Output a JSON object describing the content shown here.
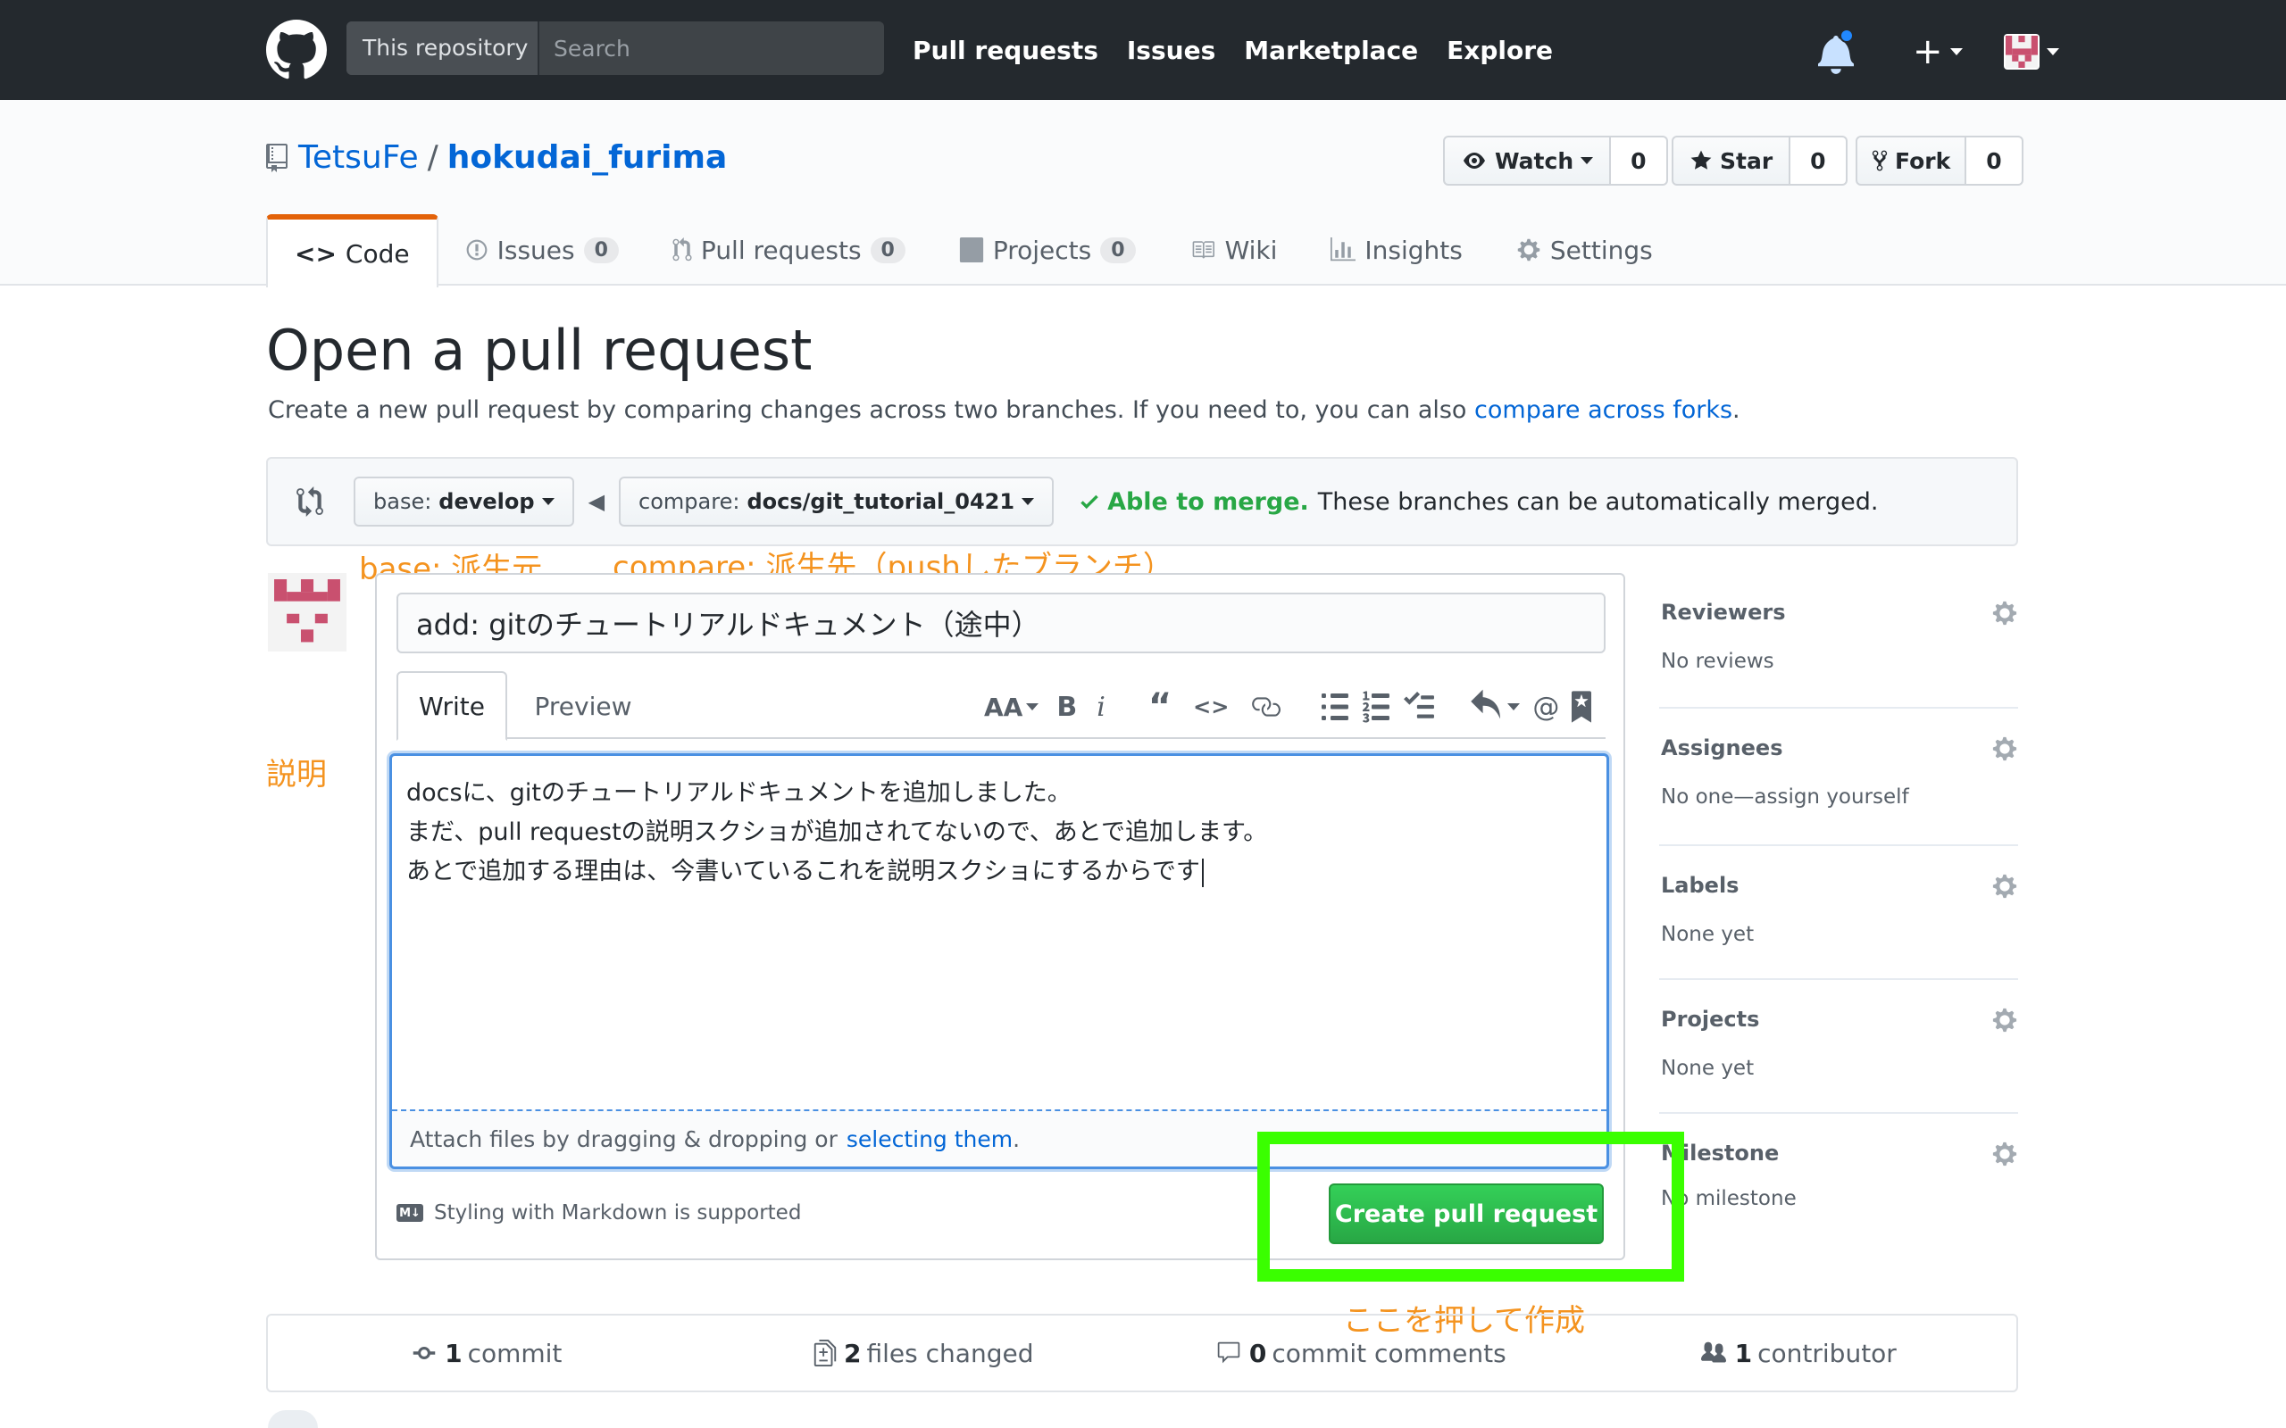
{
  "header": {
    "search_scope": "This repository",
    "search_placeholder": "Search",
    "nav": [
      "Pull requests",
      "Issues",
      "Marketplace",
      "Explore"
    ]
  },
  "repo": {
    "owner": "TetsuFe",
    "name": "hokudai_furima",
    "watch_label": "Watch",
    "watch_count": "0",
    "star_label": "Star",
    "star_count": "0",
    "fork_label": "Fork",
    "fork_count": "0",
    "tabs": {
      "code": "Code",
      "issues": "Issues",
      "issues_count": "0",
      "pulls": "Pull requests",
      "pulls_count": "0",
      "projects": "Projects",
      "projects_count": "0",
      "wiki": "Wiki",
      "insights": "Insights",
      "settings": "Settings"
    }
  },
  "page": {
    "title": "Open a pull request",
    "desc_prefix": "Create a new pull request by comparing changes across two branches. If you need to, you can also ",
    "desc_link": "compare across forks",
    "desc_suffix": "."
  },
  "range": {
    "base_label": "base:",
    "base_branch": "develop",
    "compare_label": "compare:",
    "compare_branch": "docs/git_tutorial_0421",
    "merge_status": "Able to merge.",
    "merge_text": "These branches can be automatically merged."
  },
  "annotations": {
    "base": "base: 派生元",
    "compare": "compare: 派生先（pushしたブランチ）",
    "description": "説明",
    "click_here": "ここを押して作成"
  },
  "composer": {
    "title_value": "add: gitのチュートリアルドキュメント（途中）",
    "tab_write": "Write",
    "tab_preview": "Preview",
    "body_lines": [
      "docsに、gitのチュートリアルドキュメントを追加しました。",
      "まだ、pull requestの説明スクショが追加されてないので、あとで追加します。",
      "あとで追加する理由は、今書いているこれを説明スクショにするからです"
    ],
    "attach_text": "Attach files by dragging & dropping or",
    "attach_link": "selecting them",
    "attach_suffix": ".",
    "markdown_badge": "M↓",
    "markdown_note": "Styling with Markdown is supported",
    "create_button": "Create pull request"
  },
  "sidebar": {
    "reviewers": "Reviewers",
    "reviewers_value": "No reviews",
    "assignees": "Assignees",
    "assignees_value": "No one—assign yourself",
    "labels": "Labels",
    "labels_value": "None yet",
    "projects": "Projects",
    "projects_value": "None yet",
    "milestone": "Milestone",
    "milestone_value": "No milestone"
  },
  "stats": {
    "commits_count": "1",
    "commits_label": "commit",
    "files_count": "2",
    "files_label": "files changed",
    "comments_count": "0",
    "comments_label": "commit comments",
    "contributors_count": "1",
    "contributors_label": "contributor"
  },
  "colors": {
    "header_bg": "#24292e",
    "link": "#0366d6",
    "success": "#28a745",
    "annotation": "#f4931f",
    "highlight": "#3aff00",
    "tab_accent": "#e36209"
  }
}
